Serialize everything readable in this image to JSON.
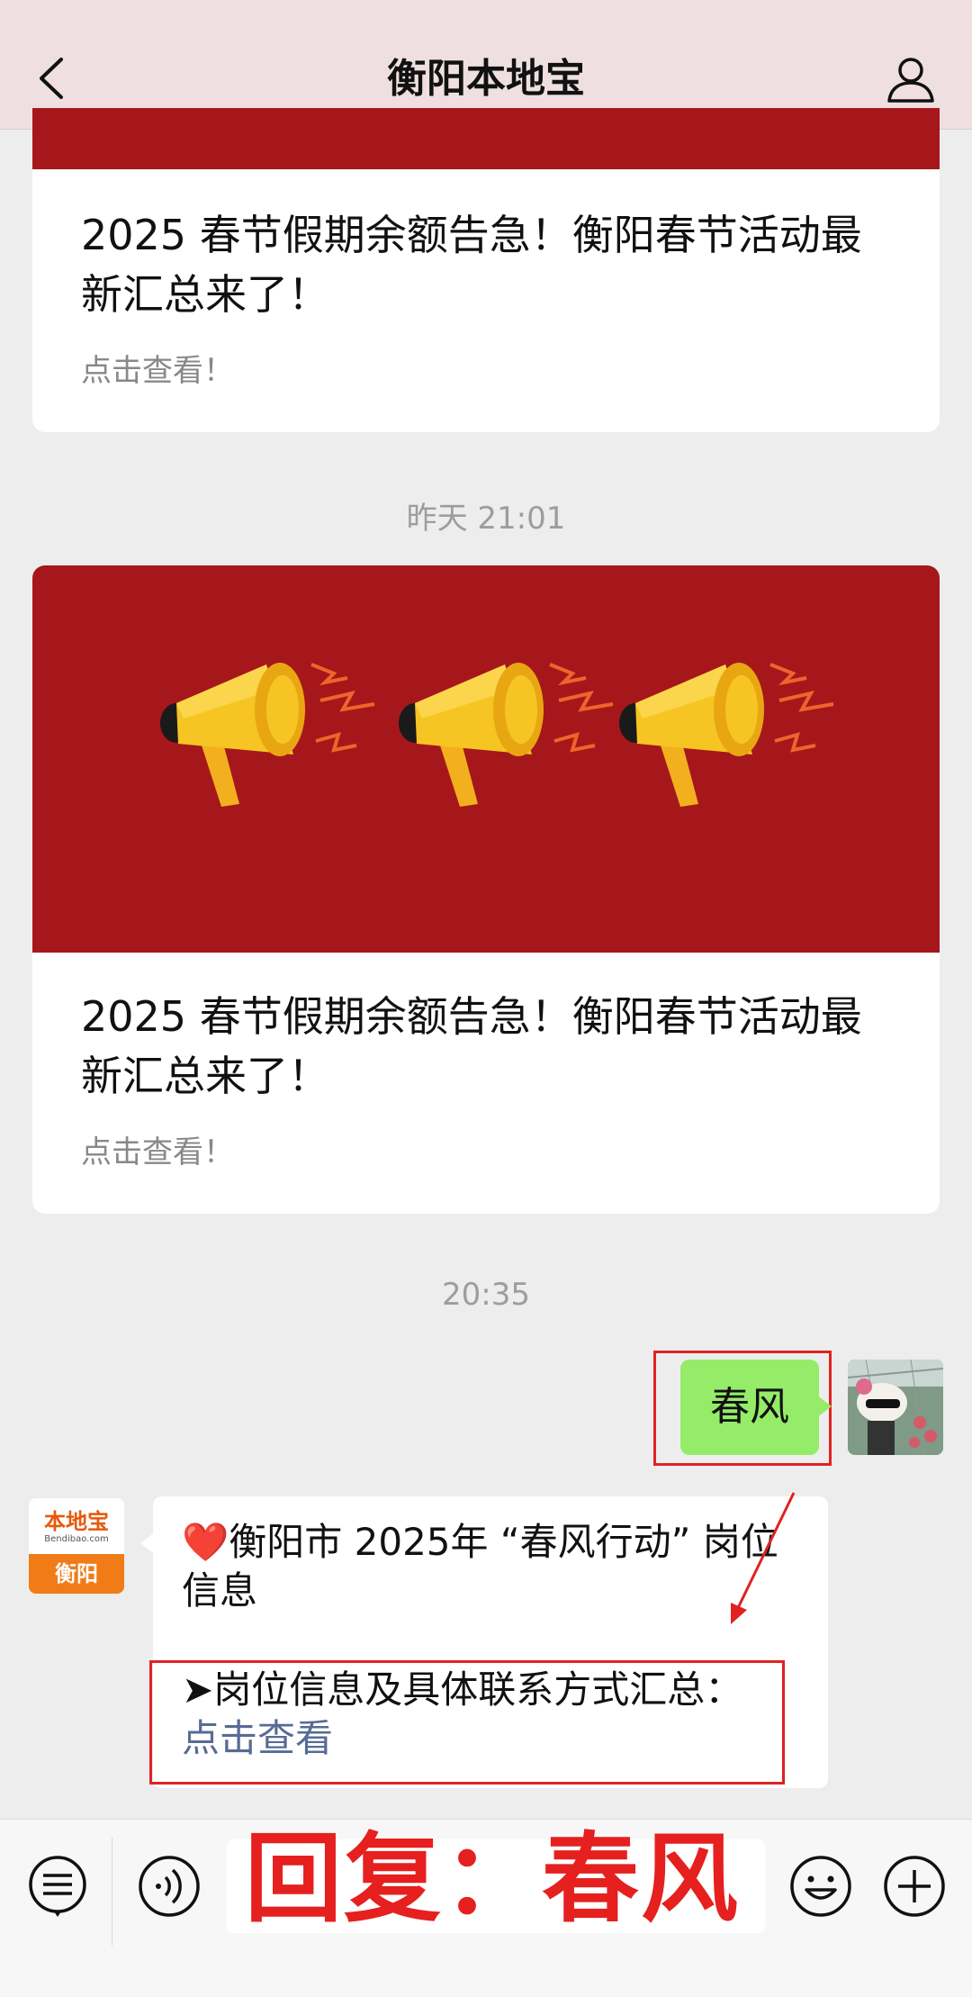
{
  "header": {
    "title": "衡阳本地宝",
    "back_icon": "chevron-left-icon",
    "profile_icon": "user-icon"
  },
  "cards": [
    {
      "title": "2025 春节假期余额告急！衡阳春节活动最新汇总来了！",
      "subtitle": "点击查看！"
    },
    {
      "title": "2025 春节假期余额告急！衡阳春节活动最新汇总来了！",
      "subtitle": "点击查看！",
      "banner_icon": "megaphone-icon"
    }
  ],
  "timestamps": [
    "昨天 21:01",
    "20:35"
  ],
  "sent_message": {
    "text": "春风"
  },
  "bot": {
    "avatar_text_top": "本地宝",
    "avatar_text_small": "Bendibao.com",
    "avatar_text_bottom": "衡阳"
  },
  "received_message": {
    "line1": "❤️衡阳市 2025年 “春风行动” 岗位信息",
    "line2_prefix": "➤岗位信息及具体联系方式汇总：",
    "link_text": "点击查看"
  },
  "overlay": {
    "text": "回复：春风"
  },
  "colors": {
    "accent_red": "#a6171c",
    "bubble_green": "#95ec69",
    "link_blue": "#576b95",
    "highlight_red": "#e02222"
  }
}
